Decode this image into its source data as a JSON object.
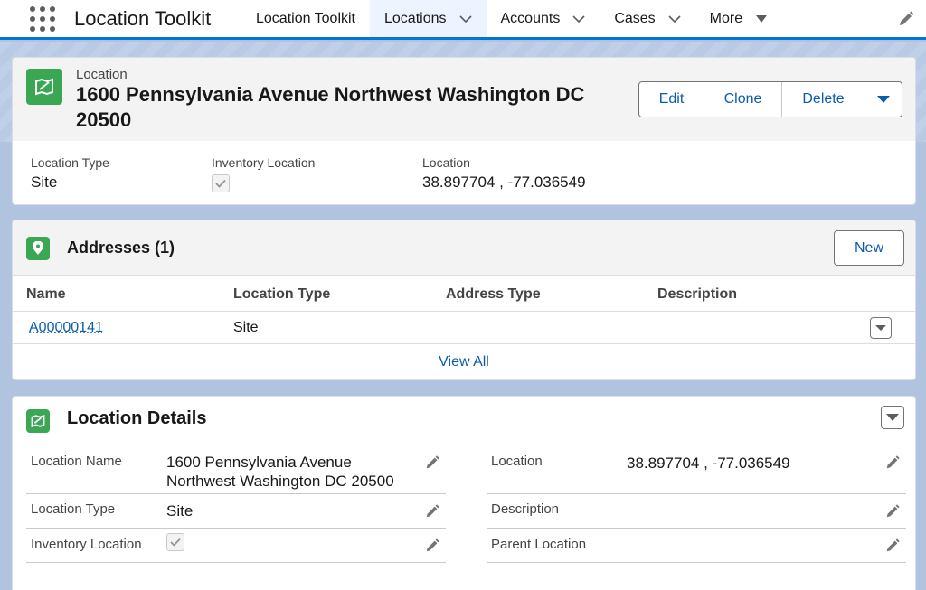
{
  "nav": {
    "app_name": "Location Toolkit",
    "items": [
      {
        "label": "Location Toolkit",
        "has_chevron": false
      },
      {
        "label": "Locations",
        "has_chevron": true,
        "active": true
      },
      {
        "label": "Accounts",
        "has_chevron": true
      },
      {
        "label": "Cases",
        "has_chevron": true
      },
      {
        "label": "More",
        "has_chevron": true
      }
    ]
  },
  "record": {
    "object_label": "Location",
    "title": "1600 Pennsylvania Avenue Northwest Washington DC 20500",
    "actions": {
      "edit": "Edit",
      "clone": "Clone",
      "delete": "Delete"
    },
    "highlights": [
      {
        "label": "Location Type",
        "value": "Site"
      },
      {
        "label": "Inventory Location",
        "checked": true
      },
      {
        "label": "Location",
        "value": "38.897704 , -77.036549"
      }
    ]
  },
  "addresses": {
    "title": "Addresses (1)",
    "new_label": "New",
    "columns": [
      "Name",
      "Location Type",
      "Address Type",
      "Description"
    ],
    "rows": [
      {
        "name": "A00000141",
        "location_type": "Site",
        "address_type": "",
        "description": ""
      }
    ],
    "view_all": "View All"
  },
  "details": {
    "title": "Location Details",
    "left": [
      {
        "label": "Location Name",
        "value_line1": "1600 Pennsylvania Avenue",
        "value_line2": "Northwest Washington DC 20500"
      },
      {
        "label": "Location Type",
        "value": "Site"
      },
      {
        "label": "Inventory Location",
        "checked": true
      }
    ],
    "right": [
      {
        "label": "Location",
        "value": "38.897704 , -77.036549"
      },
      {
        "label": "Description",
        "value": ""
      },
      {
        "label": "Parent Location",
        "value": ""
      }
    ]
  },
  "colors": {
    "accent": "#0176d3",
    "link": "#0b5cab",
    "icon_green": "#3ba755"
  }
}
